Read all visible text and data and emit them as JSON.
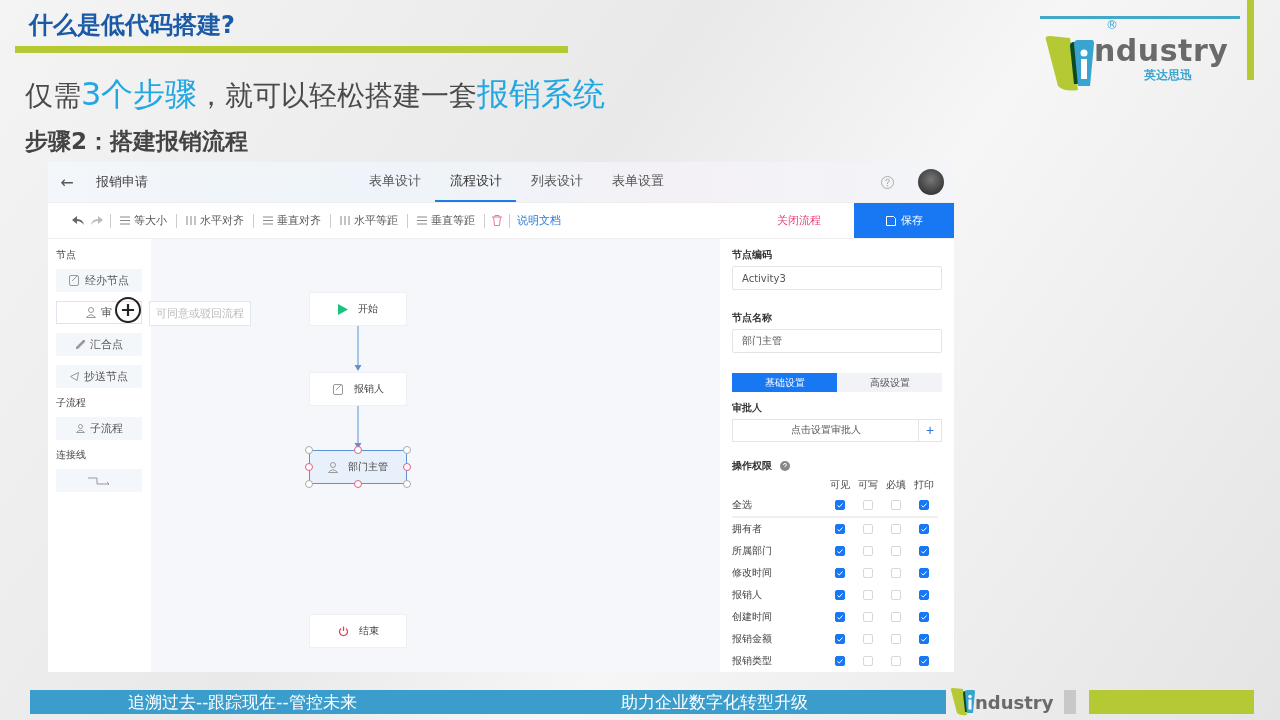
{
  "slide": {
    "title": "什么是低代码搭建?",
    "subtitle": "仅需**3个步骤**，就可以轻松搭建一套**报销系统**",
    "step_heading": "步骤2：搭建报销流程"
  },
  "logo": {
    "wordmark": "ndustry",
    "registered": "®",
    "chinese_name": "英达思迅"
  },
  "app": {
    "back": "←",
    "title": "报销申请",
    "tabs": [
      {
        "label": "表单设计",
        "selected": false
      },
      {
        "label": "流程设计",
        "selected": true
      },
      {
        "label": "列表设计",
        "selected": false
      },
      {
        "label": "表单设置",
        "selected": false
      }
    ],
    "toolbar": {
      "tools": [
        "等大小",
        "水平对齐",
        "垂直对齐",
        "水平等距",
        "垂直等距"
      ],
      "doc_link": "说明文档",
      "close_flow": "关闭流程",
      "save": "保存"
    },
    "palette": [
      {
        "title": "节点",
        "items": [
          {
            "label": "经办节点",
            "kind": "task",
            "dragging": false
          },
          {
            "label": "审",
            "kind": "approve",
            "dragging": true,
            "tooltip": "可同意或驳回流程"
          },
          {
            "label": "汇合点",
            "kind": "join",
            "dragging": false
          },
          {
            "label": "抄送节点",
            "kind": "copy",
            "dragging": false
          }
        ]
      },
      {
        "title": "子流程",
        "items": [
          {
            "label": "子流程",
            "kind": "subflow",
            "dragging": false
          }
        ]
      },
      {
        "title": "连接线",
        "items": [
          {
            "kind": "connector",
            "dragging": false
          }
        ]
      }
    ],
    "canvas": {
      "nodes": [
        {
          "label": "开始",
          "kind": "start",
          "selected": false
        },
        {
          "label": "报销人",
          "kind": "task",
          "selected": false
        },
        {
          "label": "部门主管",
          "kind": "approve",
          "selected": true
        },
        {
          "label": "结束",
          "kind": "end",
          "selected": false
        }
      ]
    },
    "properties": {
      "code_label": "节点编码",
      "code_value": "Activity3",
      "name_label": "节点名称",
      "name_value": "部门主管",
      "tabs": [
        {
          "label": "基础设置",
          "selected": true
        },
        {
          "label": "高级设置",
          "selected": false
        }
      ],
      "approver_label": "审批人",
      "approver_button": "点击设置审批人",
      "add": "+",
      "permissions": {
        "title": "操作权限",
        "columns": [
          "可见",
          "可写",
          "必填",
          "打印"
        ],
        "rows": [
          {
            "name": "全选",
            "checked": [
              true,
              false,
              false,
              true
            ]
          },
          {
            "name": "拥有者",
            "checked": [
              true,
              false,
              false,
              true
            ]
          },
          {
            "name": "所属部门",
            "checked": [
              true,
              false,
              false,
              true
            ]
          },
          {
            "name": "修改时间",
            "checked": [
              true,
              false,
              false,
              true
            ]
          },
          {
            "name": "报销人",
            "checked": [
              true,
              false,
              false,
              true
            ]
          },
          {
            "name": "创建时间",
            "checked": [
              true,
              false,
              false,
              true
            ]
          },
          {
            "name": "报销金额",
            "checked": [
              true,
              false,
              false,
              true
            ]
          },
          {
            "name": "报销类型",
            "checked": [
              true,
              false,
              false,
              true
            ]
          }
        ]
      }
    }
  },
  "footer": {
    "left": "追溯过去--跟踪现在--管控未来",
    "right": "助力企业数字化转型升级",
    "logo_wordmark": "ndustry"
  }
}
